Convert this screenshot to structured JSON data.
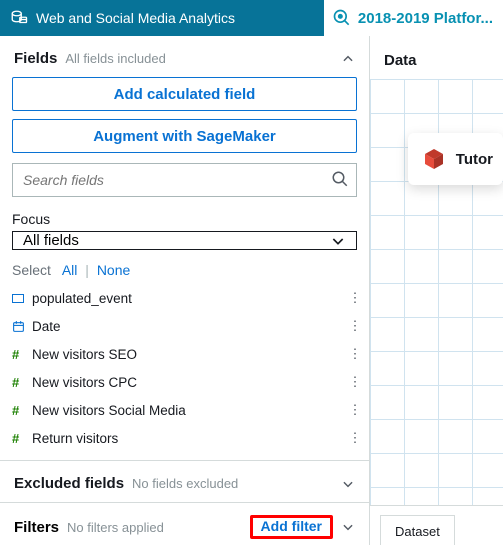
{
  "topbar": {
    "title": "Web and Social Media Analytics",
    "breadcrumb": "2018-2019 Platfor..."
  },
  "fields_section": {
    "title": "Fields",
    "subtitle": "All fields included",
    "add_calc_label": "Add calculated field",
    "augment_label": "Augment with SageMaker",
    "search_placeholder": "Search fields",
    "focus_label": "Focus",
    "focus_value": "All fields",
    "select_label": "Select",
    "select_all": "All",
    "select_none": "None",
    "items": [
      {
        "icon": "rect",
        "name": "populated_event"
      },
      {
        "icon": "date",
        "name": "Date"
      },
      {
        "icon": "hash",
        "name": "New visitors SEO"
      },
      {
        "icon": "hash",
        "name": "New visitors CPC"
      },
      {
        "icon": "hash",
        "name": "New visitors Social Media"
      },
      {
        "icon": "hash",
        "name": "Return visitors"
      }
    ]
  },
  "excluded_section": {
    "title": "Excluded fields",
    "subtitle": "No fields excluded"
  },
  "filters_section": {
    "title": "Filters",
    "subtitle": "No filters applied",
    "add_label": "Add filter"
  },
  "rightpane": {
    "data_label": "Data",
    "card_label": "Tutor",
    "tab_label": "Dataset"
  }
}
